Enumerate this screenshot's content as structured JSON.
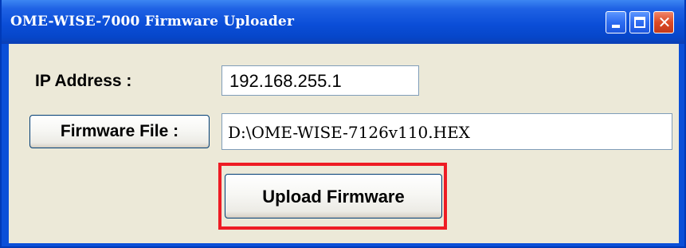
{
  "window": {
    "title": "OME-WISE-7000 Firmware Uploader",
    "controls": {
      "minimize_icon": "minimize-icon",
      "maximize_icon": "maximize-icon",
      "close_icon": "close-icon",
      "close_glyph": "✕"
    }
  },
  "form": {
    "ip_label": "IP Address :",
    "ip_value": "192.168.255.1",
    "firmware_button_label": "Firmware File :",
    "firmware_path": "D:\\OME-WISE-7126v110.HEX",
    "upload_button_label": "Upload Firmware"
  },
  "colors": {
    "titlebar": "#0b4ed8",
    "client_bg": "#ece9d8",
    "highlight": "#ee1c24",
    "close_button": "#dc4a26"
  }
}
